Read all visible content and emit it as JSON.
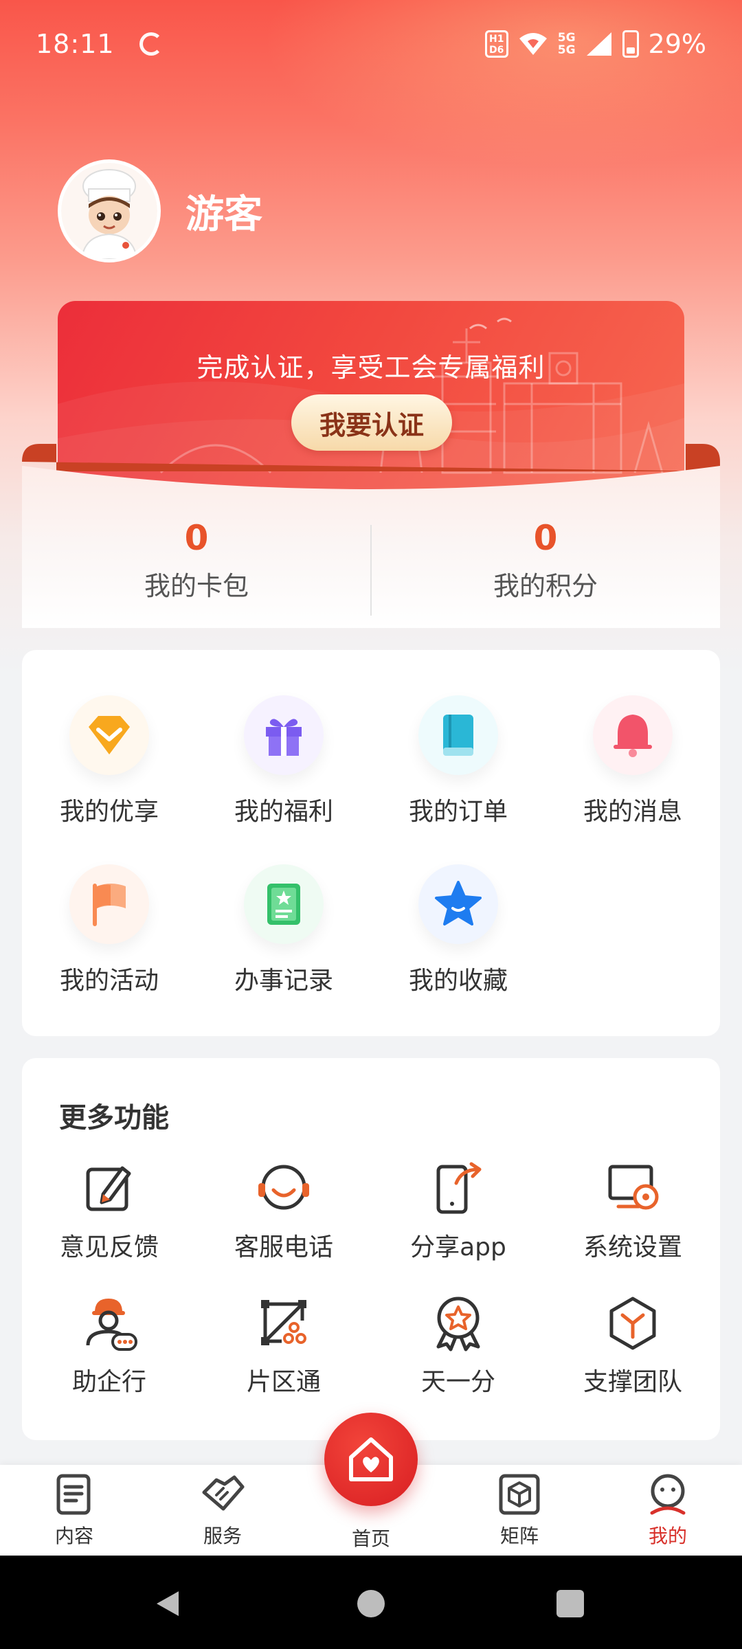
{
  "status_bar": {
    "time": "18:11",
    "battery": "29%",
    "network": "5G"
  },
  "profile": {
    "name": "游客"
  },
  "cert_banner": {
    "text": "完成认证，享受工会专属福利",
    "button": "我要认证"
  },
  "stats": [
    {
      "value": "0",
      "label": "我的卡包"
    },
    {
      "value": "0",
      "label": "我的积分"
    }
  ],
  "mine": {
    "items": [
      {
        "label": "我的优享",
        "icon": "diamond-icon",
        "color": "#f7a21b"
      },
      {
        "label": "我的福利",
        "icon": "gift-icon",
        "color": "#7b5cf0"
      },
      {
        "label": "我的订单",
        "icon": "book-icon",
        "color": "#2ab7d6"
      },
      {
        "label": "我的消息",
        "icon": "bell-icon",
        "color": "#f2546a"
      },
      {
        "label": "我的活动",
        "icon": "flag-icon",
        "color": "#f98a52"
      },
      {
        "label": "办事记录",
        "icon": "record-icon",
        "color": "#34c06a"
      },
      {
        "label": "我的收藏",
        "icon": "star-icon",
        "color": "#1e7cf0"
      }
    ]
  },
  "more": {
    "title": "更多功能",
    "items": [
      {
        "label": "意见反馈",
        "icon": "feedback-icon"
      },
      {
        "label": "客服电话",
        "icon": "headset-icon"
      },
      {
        "label": "分享app",
        "icon": "share-icon"
      },
      {
        "label": "系统设置",
        "icon": "settings-icon"
      },
      {
        "label": "助企行",
        "icon": "worker-icon"
      },
      {
        "label": "片区通",
        "icon": "area-icon"
      },
      {
        "label": "天一分",
        "icon": "badge-icon"
      },
      {
        "label": "支撑团队",
        "icon": "team-icon"
      }
    ]
  },
  "bottom_nav": {
    "items": [
      {
        "label": "内容",
        "icon": "content-icon"
      },
      {
        "label": "服务",
        "icon": "handshake-icon"
      },
      {
        "label": "首页",
        "icon": "home-icon"
      },
      {
        "label": "矩阵",
        "icon": "cube-icon"
      },
      {
        "label": "我的",
        "icon": "profile-icon"
      }
    ],
    "active": "我的"
  },
  "colors": {
    "accent": "#d8312b",
    "stat_value": "#e8532a",
    "icon_orange": "#e8632b"
  }
}
